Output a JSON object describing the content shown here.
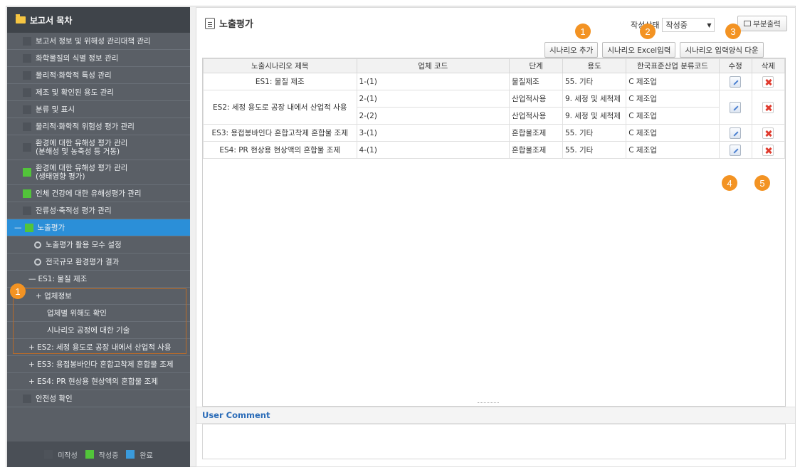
{
  "sidebar": {
    "title": "보고서 목차",
    "items": [
      {
        "label": "보고서 정보 및 위해성 관리대책 관리",
        "status": "gray"
      },
      {
        "label": "화학물질의 식별 정보 관리",
        "status": "gray"
      },
      {
        "label": "물리적·화학적 특성 관리",
        "status": "gray"
      },
      {
        "label": "제조 및 확인된 용도 관리",
        "status": "gray"
      },
      {
        "label": "분류 및 표시",
        "status": "gray"
      },
      {
        "label": "물리적·화학적 위험성 평가 관리",
        "status": "gray"
      },
      {
        "label": "환경에 대한 유해성 평가 관리",
        "label2": "(분해성 및 농축성 등 거동)",
        "status": "gray"
      },
      {
        "label": "환경에 대한 유해성 평가 관리",
        "label2": "(생태영향 평가)",
        "status": "green"
      },
      {
        "label": "인체 건강에 대한 유해성평가 관리",
        "status": "green"
      },
      {
        "label": "잔류성·축적성 평가 관리",
        "status": "gray"
      }
    ],
    "active": {
      "label": "노출평가",
      "toggle": "—"
    },
    "sub_items": [
      {
        "label": "노출평가 활용 모수 설정"
      },
      {
        "label": "전국규모 환경평가 결과"
      }
    ],
    "es1": {
      "toggle": "—",
      "label": "ES1: 물질 제조"
    },
    "es1_children": {
      "c1": "+ 업체정보",
      "c2": "업체별 위해도 확인",
      "c3": "시나리오 공정에 대한 기술"
    },
    "es_others": [
      {
        "label": "+ ES2: 세정 용도로 공장 내에서 산업적 사용"
      },
      {
        "label": "+ ES3: 용접봉바인다 혼합고착제 혼합물 조제"
      },
      {
        "label": "+ ES4: PR 현상용 현상액의 혼합물 조제"
      }
    ],
    "last": {
      "label": "안전성 확인"
    },
    "legend": {
      "not_written": "미작성",
      "writing": "작성중",
      "done": "완료"
    }
  },
  "main": {
    "title": "노출평가",
    "status_label": "작성상태",
    "status_value": "작성중",
    "print_label": "부분출력",
    "buttons": {
      "add": "시나리오 추가",
      "excel": "시나리오 Excel입력",
      "download": "시나리오 입력양식 다운"
    },
    "table": {
      "headers": [
        "노출시나리오 제목",
        "업체 코드",
        "단계",
        "용도",
        "한국표준산업 분류코드",
        "수정",
        "삭제"
      ],
      "rows": [
        {
          "title": "ES1: 물질 제조",
          "code": "1-(1)",
          "stage": "물질제조",
          "use": "55. 기타",
          "ksic": "C 제조업"
        },
        {
          "title": "ES2: 세정 용도로 공장 내에서 산업적 사용",
          "code": "2-(1)",
          "stage": "산업적사용",
          "use": "9. 세정 및 세척제",
          "ksic": "C 제조업",
          "code2": "2-(2)",
          "stage2": "산업적사용",
          "use2": "9. 세정 및 세척제",
          "ksic2": "C 제조업"
        },
        {
          "title": "ES3: 용접봉바인다 혼합고착제 혼합물 조제",
          "code": "3-(1)",
          "stage": "혼합물조제",
          "use": "55. 기타",
          "ksic": "C 제조업"
        },
        {
          "title": "ES4: PR 현상용 현상액의 혼합물 조제",
          "code": "4-(1)",
          "stage": "혼합물조제",
          "use": "55. 기타",
          "ksic": "C 제조업"
        }
      ]
    },
    "comment_title": "User Comment"
  },
  "badges": {
    "b1": "1",
    "b2": "2",
    "b3": "3",
    "b4": "4",
    "b5": "5",
    "b6": "1"
  },
  "colors": {
    "accent": "#2b8fd8",
    "badge": "#f39323",
    "green": "#52c43a"
  }
}
